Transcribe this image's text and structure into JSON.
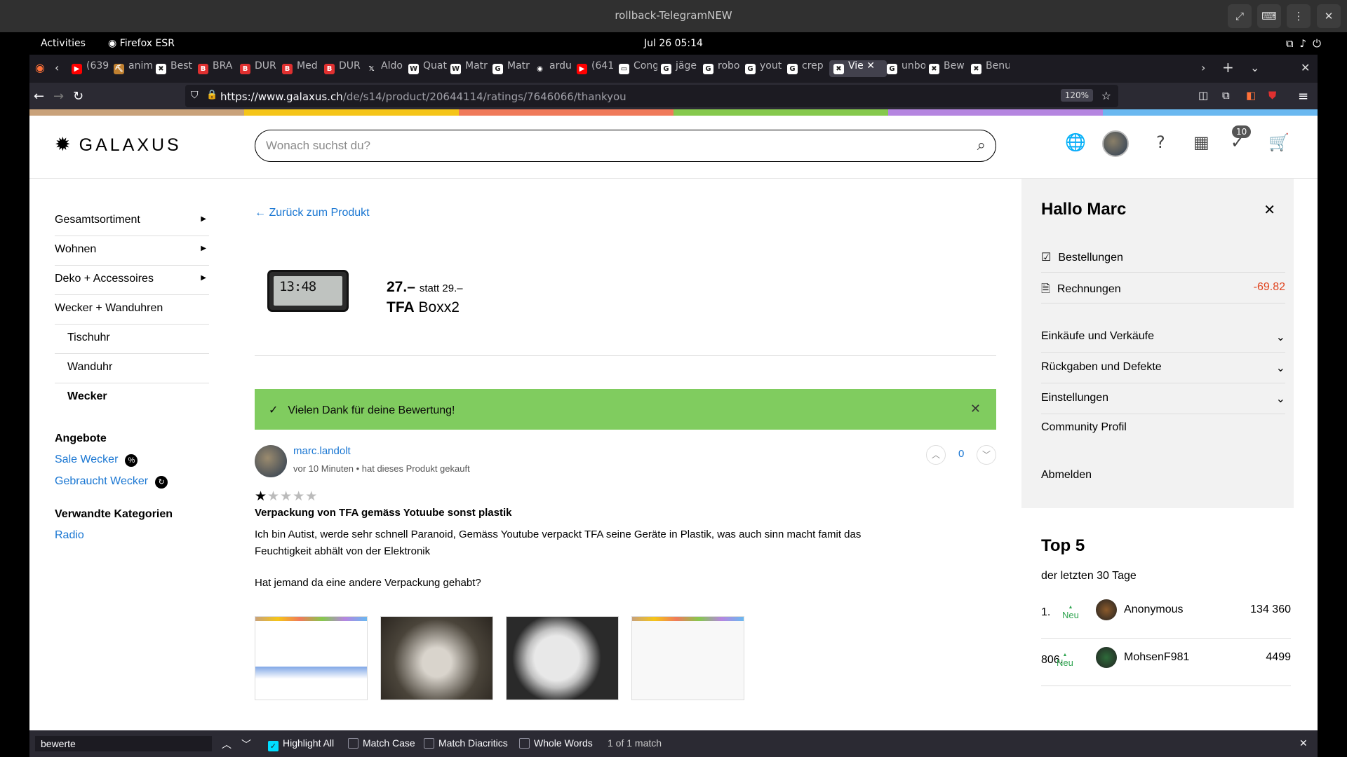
{
  "window": {
    "title": "rollback-TelegramNEW"
  },
  "gnome": {
    "activities": "Activities",
    "app": "Firefox ESR",
    "clock": "Jul 26  05:14"
  },
  "tabs": [
    {
      "label": "(639",
      "color": "#ff0000",
      "glyph": "▶"
    },
    {
      "label": "anim",
      "color": "#c08030",
      "glyph": "⛏"
    },
    {
      "label": "Best",
      "color": "#ffffff",
      "glyph": "✖"
    },
    {
      "label": "BRA",
      "color": "#e03030",
      "glyph": "B"
    },
    {
      "label": "DUR",
      "color": "#e03030",
      "glyph": "B"
    },
    {
      "label": "Med",
      "color": "#e03030",
      "glyph": "B"
    },
    {
      "label": "DUR",
      "color": "#e03030",
      "glyph": "B"
    },
    {
      "label": "Aldo",
      "color": "#1c1b22",
      "glyph": "𝕏"
    },
    {
      "label": "Quat",
      "color": "#ffffff",
      "glyph": "W"
    },
    {
      "label": "Matr",
      "color": "#ffffff",
      "glyph": "W"
    },
    {
      "label": "Matr",
      "color": "#ffffff",
      "glyph": "G"
    },
    {
      "label": "ardu",
      "color": "#1c1b22",
      "glyph": "◉"
    },
    {
      "label": "(641",
      "color": "#ff0000",
      "glyph": "▶"
    },
    {
      "label": "Cong",
      "color": "#ffffff",
      "glyph": "▭"
    },
    {
      "label": "jäge",
      "color": "#ffffff",
      "glyph": "G"
    },
    {
      "label": "robo",
      "color": "#ffffff",
      "glyph": "G"
    },
    {
      "label": "yout",
      "color": "#ffffff",
      "glyph": "G"
    },
    {
      "label": "crep",
      "color": "#ffffff",
      "glyph": "G"
    },
    {
      "label": "Vie",
      "color": "#ffffff",
      "glyph": "✖",
      "active": true
    },
    {
      "label": "unbo",
      "color": "#ffffff",
      "glyph": "G"
    },
    {
      "label": "Bew",
      "color": "#ffffff",
      "glyph": "✖"
    },
    {
      "label": "Benu",
      "color": "#ffffff",
      "glyph": "✖"
    }
  ],
  "nav": {
    "url_host": "https://www.galaxus.ch",
    "url_path": "/de/s14/product/20644114/ratings/7646066/thankyou",
    "zoom": "120%"
  },
  "colors": {
    "stripe": [
      "#c9a27a",
      "#f5c518",
      "#f07a5a",
      "#86c94d",
      "#b585e0",
      "#6ab8f0"
    ],
    "link": "#1976d2",
    "banner": "#80cc5f"
  },
  "header": {
    "logo": "GALAXUS",
    "search_placeholder": "Wonach suchst du?",
    "notif_count": "10"
  },
  "sidebar": {
    "categories": [
      "Gesamtsortiment",
      "Wohnen",
      "Deko + Accessoires",
      "Wecker + Wanduhren"
    ],
    "subcategories": [
      "Tischuhr",
      "Wanduhr",
      "Wecker"
    ],
    "offers_heading": "Angebote",
    "offers": [
      "Sale Wecker",
      "Gebraucht Wecker"
    ],
    "related_heading": "Verwandte Kategorien",
    "related": [
      "Radio"
    ]
  },
  "main": {
    "back": "Zurück zum Produkt",
    "lcd": "13:48",
    "price": "27.–",
    "statt": "statt 29.–",
    "brand": "TFA",
    "model": "Boxx2",
    "banner": "Vielen Dank für deine Bewertung!",
    "review": {
      "user": "marc.landolt",
      "meta": "vor 10 Minuten • hat dieses Produkt gekauft",
      "votes": "0",
      "rating": 1,
      "rating_max": 5,
      "title": "Verpackung von TFA gemäss Yotuube sonst plastik",
      "body": "Ich bin Autist, werde sehr schnell Paranoid, Gemäss Youtube verpackt TFA seine Geräte in Plastik, was auch sinn macht famit das Feuchtigkeit abhält von der Elektronik",
      "question": "Hat jemand da eine andere Verpackung gehabt?"
    }
  },
  "panel": {
    "greeting": "Hallo Marc",
    "orders": "Bestellungen",
    "invoices": "Rechnungen",
    "invoices_amount": "-69.82",
    "sections": [
      "Einkäufe und Verkäufe",
      "Rückgaben und Defekte",
      "Einstellungen"
    ],
    "community": "Community Profil",
    "logout": "Abmelden"
  },
  "top5": {
    "title": "Top 5",
    "subtitle": "der letzten 30 Tage",
    "rows": [
      {
        "rank": "1.",
        "tag": "Neu",
        "name": "Anonymous",
        "points": "134 360"
      },
      {
        "rank": "806.",
        "tag": "Neu",
        "name": "MohsenF981",
        "points": "4499"
      }
    ]
  },
  "findbar": {
    "query": "bewerte",
    "highlight_all": "Highlight All",
    "match_case": "Match Case",
    "match_diacritics": "Match Diacritics",
    "whole_words": "Whole Words",
    "result": "1 of 1 match"
  }
}
